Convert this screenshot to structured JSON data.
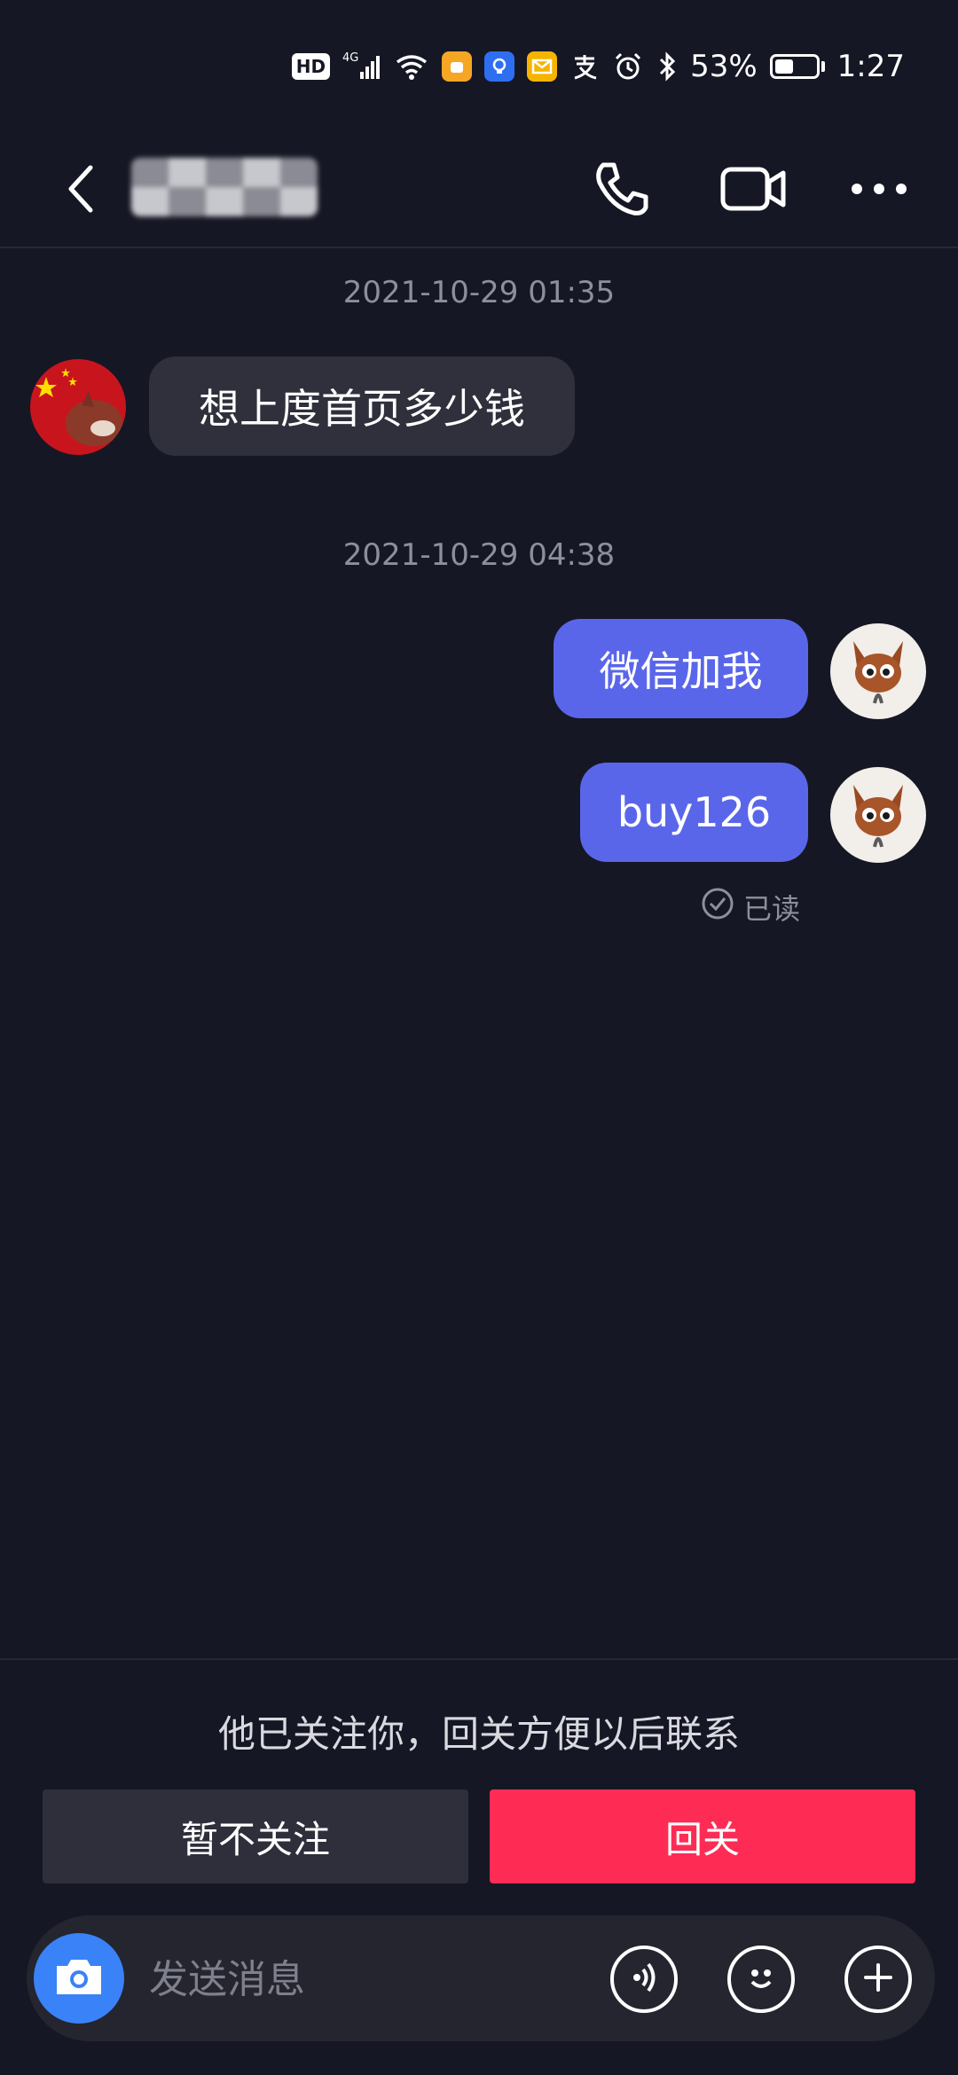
{
  "status_bar": {
    "hd_label": "HD",
    "network": "4G",
    "battery": "53%",
    "battery_level": 0.53,
    "time": "1:27",
    "icons": [
      "hd-icon",
      "signal-icon",
      "wifi-icon",
      "app-notification-icon",
      "app-notification-icon",
      "mail-icon",
      "alipay-icon",
      "alarm-icon",
      "bluetooth-icon",
      "battery-icon"
    ]
  },
  "nav": {
    "back_icon": "chevron-left-icon",
    "call_icon": "phone-icon",
    "video_icon": "video-camera-icon",
    "more_icon": "more-icon"
  },
  "messages": [
    {
      "timestamp": "2021-10-29 01:35"
    },
    {
      "direction": "incoming",
      "text": "想上度首页多少钱"
    },
    {
      "timestamp": "2021-10-29 04:38"
    },
    {
      "direction": "outgoing",
      "text": "微信加我"
    },
    {
      "direction": "outgoing",
      "text": "buy126"
    }
  ],
  "read_status": "已读",
  "follow_prompt": {
    "text": "他已关注你，回关方便以后联系",
    "decline_label": "暂不关注",
    "follow_label": "回关"
  },
  "input": {
    "placeholder": "发送消息",
    "camera_icon": "camera-icon",
    "voice_icon": "voice-icon",
    "emoji_icon": "emoji-icon",
    "add_icon": "plus-icon"
  },
  "colors": {
    "background": "#161724",
    "outgoing_bubble": "#5a66ea",
    "incoming_bubble": "#2f303b",
    "follow_button": "#fe2c55",
    "camera_button": "#3a82f7"
  }
}
